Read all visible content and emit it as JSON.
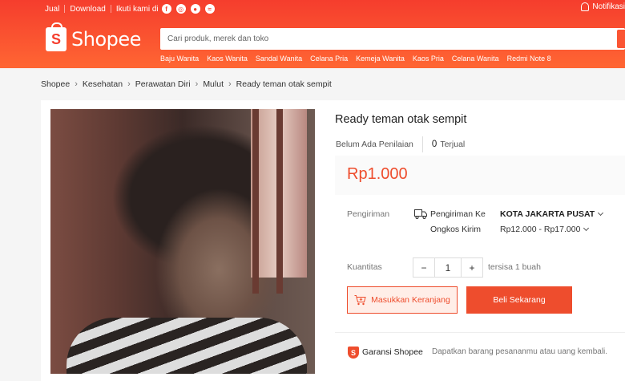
{
  "topbar": {
    "sell": "Jual",
    "download": "Download",
    "follow": "Ikuti kami di",
    "social_icons": [
      "facebook-icon",
      "instagram-icon",
      "line-icon",
      "messenger-icon"
    ],
    "notifications": "Notifikasi"
  },
  "logo": {
    "text": "Shopee",
    "mark": "S"
  },
  "search": {
    "placeholder": "Cari produk, merek dan toko",
    "value": ""
  },
  "keywords": [
    "Baju Wanita",
    "Kaos Wanita",
    "Sandal Wanita",
    "Celana Pria",
    "Kemeja Wanita",
    "Kaos Pria",
    "Celana Wanita",
    "Redmi Note 8"
  ],
  "breadcrumb": [
    "Shopee",
    "Kesehatan",
    "Perawatan Diri",
    "Mulut",
    "Ready teman otak sempit"
  ],
  "product": {
    "title": "Ready teman otak sempit",
    "rating_text": "Belum Ada Penilaian",
    "sold_count": "0",
    "sold_label": "Terjual",
    "price": "Rp1.000"
  },
  "shipping": {
    "label": "Pengiriman",
    "to_label": "Pengiriman Ke",
    "destination": "KOTA JAKARTA PUSAT",
    "cost_label": "Ongkos Kirim",
    "cost_range": "Rp12.000 - Rp17.000"
  },
  "quantity": {
    "label": "Kuantitas",
    "minus": "−",
    "value": "1",
    "plus": "+",
    "stock": "tersisa 1 buah"
  },
  "actions": {
    "add_to_cart": "Masukkan Keranjang",
    "buy_now": "Beli Sekarang"
  },
  "guarantee": {
    "title": "Garansi Shopee",
    "description": "Dapatkan barang pesananmu atau uang kembali."
  },
  "colors": {
    "brand": "#ee4d2d",
    "header_top": "#f53d2d",
    "header_bottom": "#ff6633"
  }
}
